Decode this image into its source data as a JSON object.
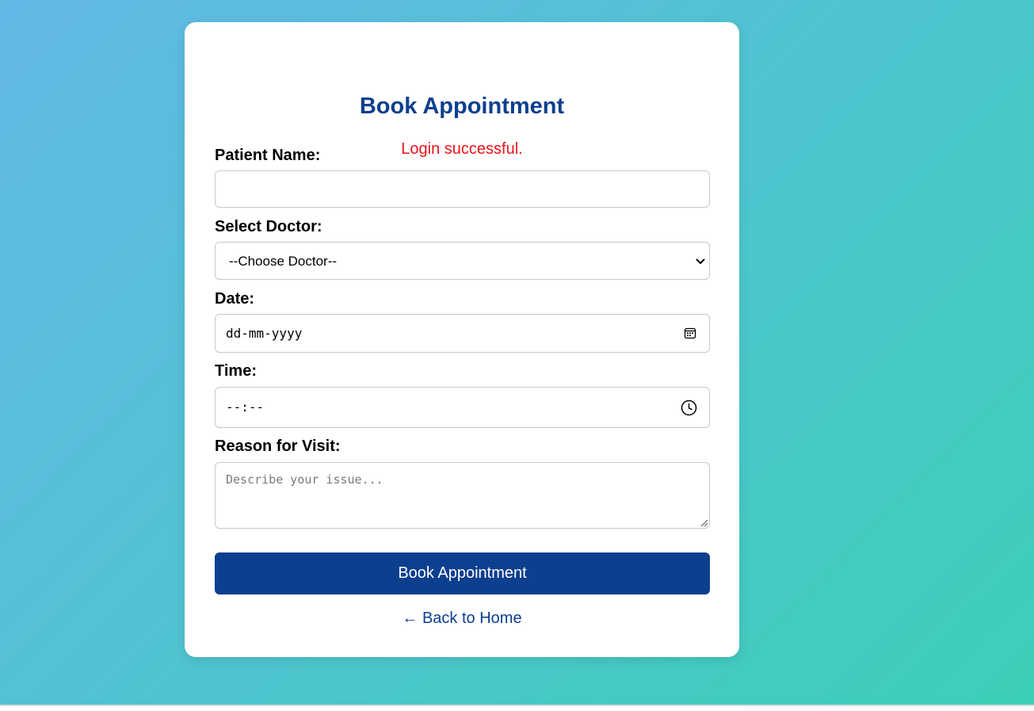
{
  "page": {
    "title": "Book Appointment",
    "status_message": "Login successful.",
    "colors": {
      "primary": "#0d3f8f",
      "status": "#e8141c",
      "gradient_start": "#63b8e6",
      "gradient_end": "#3ccfb7"
    }
  },
  "form": {
    "patient_name": {
      "label": "Patient Name:",
      "value": ""
    },
    "doctor": {
      "label": "Select Doctor:",
      "selected": "--Choose Doctor--"
    },
    "date": {
      "label": "Date:",
      "value": "dd-mm-yyyy",
      "icon": "calendar-icon"
    },
    "time": {
      "label": "Time:",
      "value": "--:--",
      "icon": "clock-icon"
    },
    "reason": {
      "label": "Reason for Visit:",
      "placeholder": "Describe your issue..."
    },
    "submit_label": "Book Appointment"
  },
  "back_link": "← Back to Home"
}
